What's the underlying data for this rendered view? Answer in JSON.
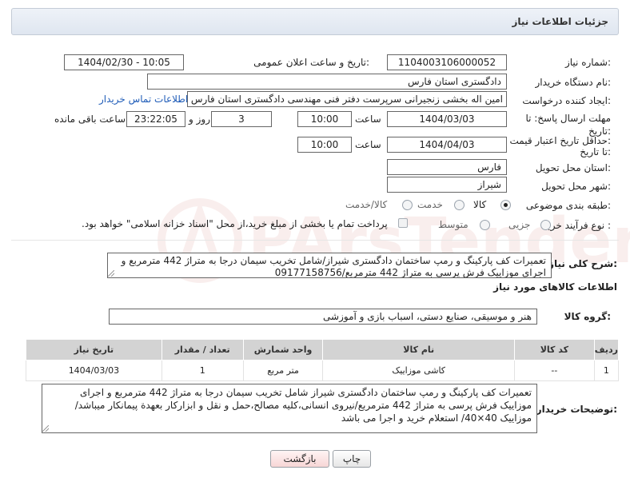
{
  "header": {
    "title": "جزئیات اطلاعات نیاز"
  },
  "fields": {
    "need_number_label": "شماره نیاز:",
    "need_number": "1104003106000052",
    "announce_label": "تاریخ و ساعت اعلان عمومی:",
    "announce_value": "1404/02/30 - 10:05",
    "buyer_org_label": "نام دستگاه خریدار:",
    "buyer_org": "دادگستری استان فارس",
    "requester_label": "ایجاد کننده درخواست:",
    "requester": "امین اله بخشی زنجیرانی سرپرست دفتر فنی مهندسی دادگستری استان فارس",
    "buyer_contact_link": "اطلاعات تماس خریدار",
    "deadline_label_1": "مهلت ارسال پاسخ: تا",
    "deadline_label_2": "تاریخ:",
    "deadline_date": "1404/03/03",
    "time_label": "ساعت",
    "deadline_time": "10:00",
    "days_value": "3",
    "days_label": "روز و",
    "remaining_time": "23:22:05",
    "remaining_label": "ساعت باقی مانده",
    "validity_label_1": "حداقل تاریخ اعتبار قیمت:",
    "validity_label_2": "تا تاریخ:",
    "validity_date": "1404/04/03",
    "validity_time": "10:00",
    "province_label": "استان محل تحویل:",
    "province": "فارس",
    "city_label": "شهر محل تحویل:",
    "city": "شیراز",
    "category_label": "طبقه بندی موضوعی:",
    "category_options": [
      "کالا",
      "خدمت",
      "کالا/خدمت"
    ],
    "category_selected": "کالا",
    "process_label": "نوع فرآیند خرید :",
    "process_options": [
      "جزیی",
      "متوسط"
    ],
    "process_selected": "",
    "payment_note": "پرداخت تمام یا بخشی از مبلغ خرید،از محل \"اسناد خزانه اسلامی\" خواهد بود."
  },
  "description": {
    "label": "شرح کلی نیاز:",
    "text": "تعمیرات کف پارکینگ و رمپ ساختمان دادگستری شیراز/شامل تخریب سیمان درجا به متراژ 442 مترمربع و اجرای موزاییک فرش پرسی به متراژ 442 مترمربع/09177158756"
  },
  "goods_section": {
    "title": "اطلاعات کالاهای مورد نیاز",
    "group_label": "گروه کالا:",
    "group_value": "هنر و موسیقی، صنایع دستی، اسباب بازی و آموزشی"
  },
  "table": {
    "headers": [
      "ردیف",
      "کد کالا",
      "نام کالا",
      "واحد شمارش",
      "تعداد / مقدار",
      "تاریخ نیاز"
    ],
    "rows": [
      [
        "1",
        "--",
        "کاشی موزاییک",
        "متر مربع",
        "1",
        "1404/03/03"
      ]
    ]
  },
  "buyer_notes": {
    "label": "توضیحات خریدار:",
    "text": "تعمیرات کف پارکینگ و رمپ ساختمان دادگستری شیراز شامل تخریب سیمان درجا به متراژ 442 مترمربع و اجرای موزاییک فرش پرسی به متراژ 442 مترمربع/نیروی انسانی،کلیه مصالح،حمل و نقل و ابزارکار بعهدة پیمانکار میباشد/موزاییک 40×40/ استعلام خرید و اجرا می باشد"
  },
  "buttons": {
    "print": "چاپ",
    "back": "بازگشت"
  },
  "watermark": {
    "text": "PArsTender.net"
  }
}
